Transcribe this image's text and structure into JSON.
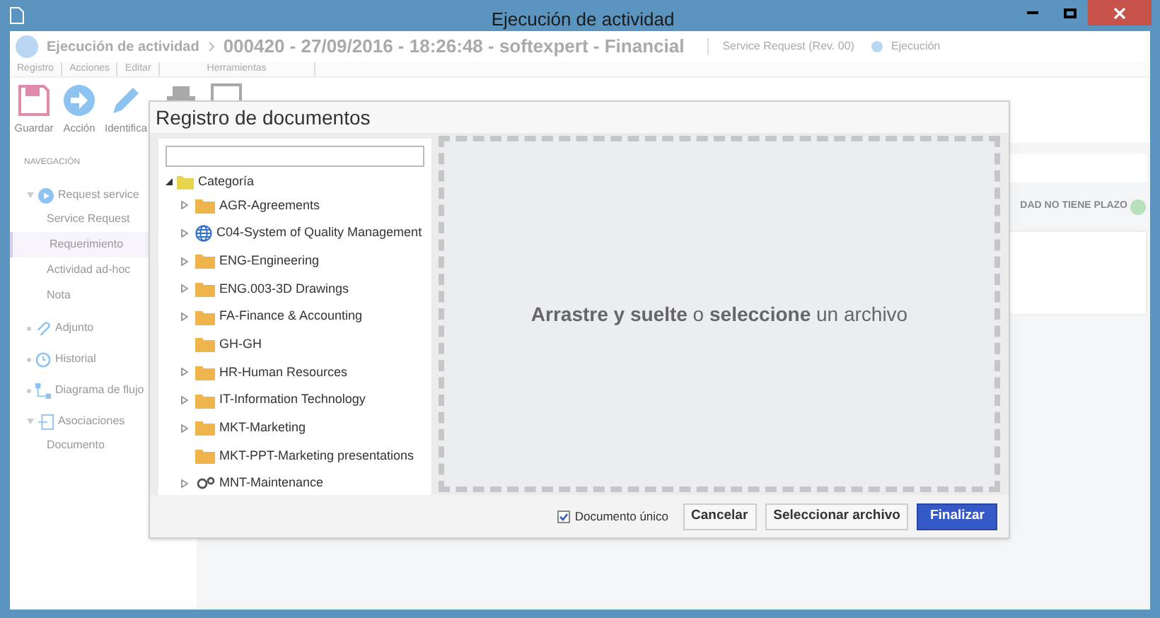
{
  "window": {
    "title": "Ejecución de actividad"
  },
  "header": {
    "module": "Ejecución de actividad",
    "record": "000420 - 27/09/2016 - 18:26:48 - softexpert - Financial",
    "process": "Service Request (Rev. 00)",
    "status": "Ejecución"
  },
  "ribbon": {
    "groups": [
      "Registro",
      "Acciones",
      "Editar",
      "Herramientas"
    ],
    "buttons": [
      {
        "label": "Guardar",
        "kind": "save"
      },
      {
        "label": "Acción",
        "kind": "action"
      },
      {
        "label": "Identifica",
        "kind": "edit"
      },
      {
        "kind": "print"
      },
      {
        "kind": "form"
      }
    ]
  },
  "navigation": {
    "title": "NAVEGACIÓN",
    "items": [
      {
        "label": "Request service",
        "kind": "play",
        "expanded": true,
        "children": [
          {
            "label": "Service Request",
            "selected": false
          },
          {
            "label": "Requerimiento",
            "selected": true
          },
          {
            "label": "Actividad ad-hoc",
            "selected": false
          },
          {
            "label": "Nota",
            "selected": false
          }
        ]
      },
      {
        "label": "Adjunto",
        "kind": "clip",
        "expanded": false
      },
      {
        "label": "Historial",
        "kind": "history",
        "expanded": false
      },
      {
        "label": "Diagrama de flujo",
        "kind": "flow",
        "expanded": false
      },
      {
        "label": "Asociaciones",
        "kind": "assoc",
        "expanded": true,
        "children": [
          {
            "label": "Documento",
            "selected": false
          }
        ]
      }
    ]
  },
  "deadline": {
    "text": "DAD NO TIENE PLAZO"
  },
  "dialog": {
    "title": "Registro de documentos",
    "tree": {
      "label": "Categoría",
      "expanded": true,
      "children": [
        {
          "label": "AGR-Agreements",
          "kind": "folder",
          "expandable": true
        },
        {
          "label": "C04-System of Quality Management",
          "kind": "globe",
          "expandable": true
        },
        {
          "label": "ENG-Engineering",
          "kind": "folder",
          "expandable": true
        },
        {
          "label": "ENG.003-3D Drawings",
          "kind": "folder",
          "expandable": true
        },
        {
          "label": "FA-Finance & Accounting",
          "kind": "folder",
          "expandable": true
        },
        {
          "label": "GH-GH",
          "kind": "folder",
          "expandable": false
        },
        {
          "label": "HR-Human Resources",
          "kind": "folder",
          "expandable": true
        },
        {
          "label": "IT-Information Technology",
          "kind": "folder",
          "expandable": true
        },
        {
          "label": "MKT-Marketing",
          "kind": "folder",
          "expandable": true
        },
        {
          "label": "MKT-PPT-Marketing presentations",
          "kind": "folder",
          "expandable": false
        },
        {
          "label": "MNT-Maintenance",
          "kind": "gear",
          "expandable": true
        }
      ]
    },
    "dropzone": {
      "text": "**Arrastre y suelte** o **seleccione** un archivo"
    },
    "single_document": {
      "label": "Documento único",
      "checked": true
    },
    "buttons": [
      {
        "label": "Cancelar",
        "kind": "default"
      },
      {
        "label": "Seleccionar archivo",
        "kind": "default"
      },
      {
        "label": "Finalizar",
        "kind": "primary"
      }
    ]
  }
}
